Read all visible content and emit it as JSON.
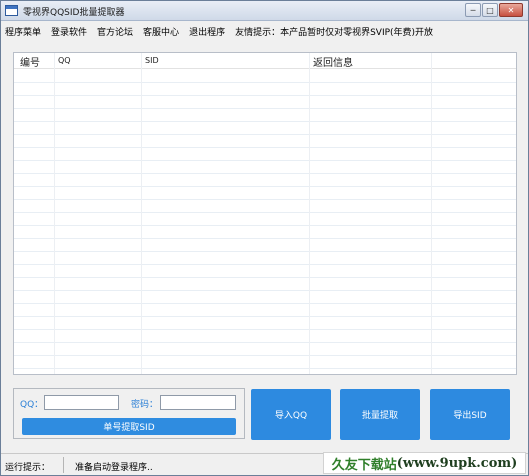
{
  "window": {
    "title": "零视界QQSID批量提取器",
    "buttons": {
      "minimize": "─",
      "maximize": "□",
      "close": "✕"
    }
  },
  "menu": {
    "items": [
      "程序菜单",
      "登录软件",
      "官方论坛",
      "客服中心",
      "退出程序"
    ],
    "notice": "友情提示：本产品暂时仅对零视界SVIP(年费)开放"
  },
  "table": {
    "columns": [
      "编号",
      "QQ",
      "SID",
      "返回信息"
    ]
  },
  "login": {
    "qq_label": "QQ：",
    "qq_value": "",
    "password_label": "密码：",
    "password_value": "",
    "single_extract_button": "单号提取SID"
  },
  "actions": {
    "import_qq": "导入QQ",
    "batch_extract": "批量提取",
    "export_sid": "导出SID"
  },
  "status": {
    "label": "运行提示：",
    "text": "准备启动登录程序.."
  },
  "watermark": {
    "text_green": "久友下载站",
    "text_dark": "(www.9upk.com)"
  },
  "colors": {
    "accent_button": "#2d8ae0",
    "label_blue": "#2a7fd6",
    "watermark_green": "#2f7f2a"
  }
}
